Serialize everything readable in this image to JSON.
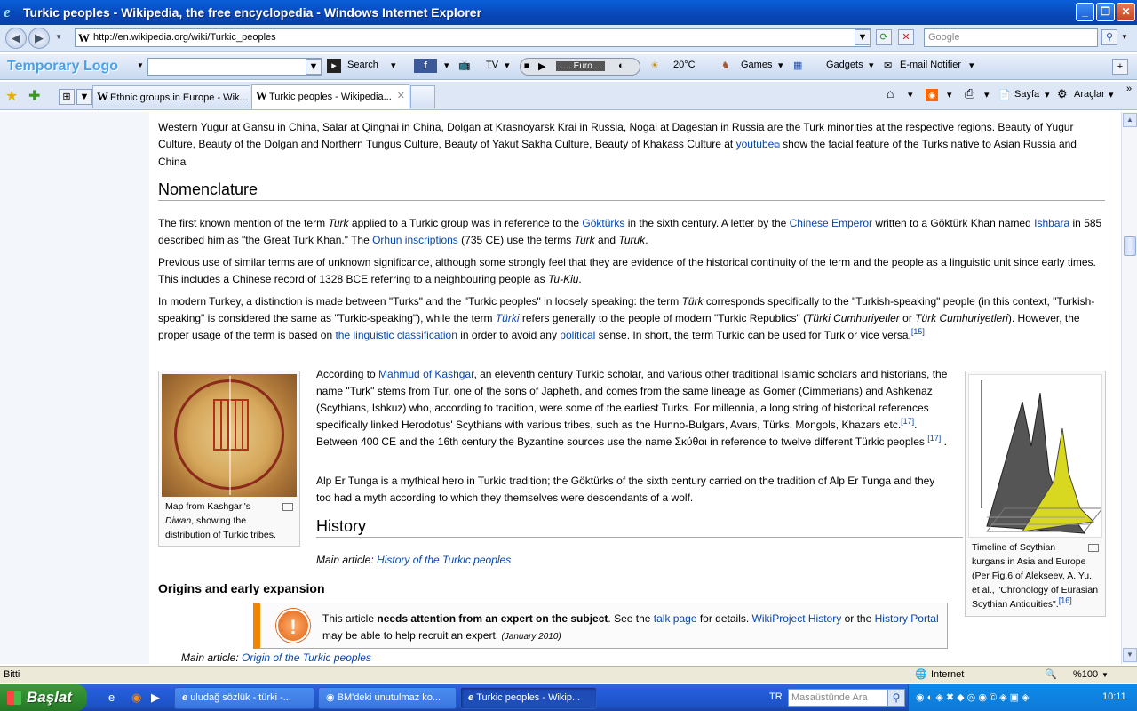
{
  "window": {
    "title": "Turkic peoples - Wikipedia, the free encyclopedia - Windows Internet Explorer"
  },
  "address": {
    "url": "http://en.wikipedia.org/wiki/Turkic_peoples",
    "search_placeholder": "Google"
  },
  "toolbar": {
    "logo": "Temporary Logo",
    "search_label": "Search",
    "tv_label": "TV",
    "radio_label": "..... Euro ...",
    "weather_label": "20°C",
    "games_label": "Games",
    "gadgets_label": "Gadgets",
    "email_label": "E-mail Notifier"
  },
  "tabs": [
    {
      "label": "Ethnic groups in Europe - Wik..."
    },
    {
      "label": "Turkic peoples - Wikipedia..."
    }
  ],
  "command_bar": {
    "page_label": "Sayfa",
    "tools_label": "Araçlar"
  },
  "article": {
    "p0": "Western Yugur at Gansu in China, Salar at Qinghai in China, Dolgan at Krasnoyarsk Krai in Russia, Nogai at Dagestan in Russia are the Turk minorities at the respective regions. Beauty of Yugur Culture, Beauty of the Dolgan and Northern Tungus Culture, Beauty of Yakut Sakha Culture, Beauty of Khakass Culture at",
    "p0_link": "youtube",
    "p0_tail": "show the facial feature of the Turks native to Asian Russia and China",
    "h_nomenclature": "Nomenclature",
    "n1": {
      "a": "The first known mention of the term",
      "turk": "Turk",
      "b": "applied to a Turkic group was in reference to the",
      "gokturks": "Göktürks",
      "c": "in the sixth century. A letter by the",
      "emperor": "Chinese Emperor",
      "d": "written to a Göktürk Khan named",
      "ishbara": "Ishbara",
      "e": "in 585 described him as \"the Great Turk Khan.\" The",
      "orhun": "Orhun inscriptions",
      "f": "(735 CE) use the terms",
      "turk2": "Turk",
      "and": "and",
      "turuk": "Turuk",
      "end": "."
    },
    "n2": {
      "a": "Previous use of similar terms are of unknown significance, although some strongly feel that they are evidence of the historical continuity of the term and the people as a linguistic unit since early times. This includes a Chinese record of 1328 BCE referring to a neighbouring people as",
      "tukiu": "Tu-Kiu",
      "end": "."
    },
    "n3": {
      "a": "In modern Turkey, a distinction is made between \"Turks\" and the \"Turkic peoples\" in loosely speaking: the term",
      "turk": "Türk",
      "b": "corresponds specifically to the \"Turkish-speaking\" people (in this context, \"Turkish-speaking\" is considered the same as \"Turkic-speaking\"), while the term",
      "turki": "Türki",
      "c": "refers generally to the people of modern \"Turkic Republics\" (",
      "cumh1": "Türki Cumhuriyetler",
      "or": "or",
      "cumh2": "Türk Cumhuriyetleri",
      "d": "). However, the proper usage of the term is based on",
      "ling": "the linguistic classification",
      "e": "in order to avoid any",
      "political": "political",
      "f": "sense. In short, the term Turkic can be used for Turk or vice versa.",
      "ref": "[15]"
    },
    "k1": {
      "a": "According to",
      "mahmud": "Mahmud of Kashgar",
      "b": ", an eleventh century Turkic scholar, and various other traditional Islamic scholars and historians, the name \"Turk\" stems from Tur, one of the sons of Japheth, and comes from the same lineage as Gomer (Cimmerians) and Ashkenaz (Scythians, Ishkuz) who, according to tradition, were some of the earliest Turks. For millennia, a long string of historical references specifically linked Herodotus' Scythians with various tribes, such as the Hunno-Bulgars, Avars, Türks, Mongols, Khazars etc.",
      "ref1": "[17]",
      "c": ". Between 400 CE and the 16th century the Byzantine sources use the name Σκύθαι in reference to twelve different Türkic peoples",
      "ref2": "[17]",
      "end": "."
    },
    "k2": "Alp Er Tunga is a mythical hero in Turkic tradition; the Göktürks of the sixth century carried on the tradition of Alp Er Tunga and they too had a myth according to which they themselves were descendants of a wolf.",
    "h_history": "History",
    "main1_label": "Main article:",
    "main1_link": "History of the Turkic peoples",
    "h_origins": "Origins and early expansion",
    "ambox": {
      "a": "This article",
      "bold": "needs attention from an expert on the subject",
      "b": ". See the",
      "talk": "talk page",
      "c": "for details.",
      "proj": "WikiProject History",
      "d": "or the",
      "portal": "History Portal",
      "e": "may be able to help recruit an expert.",
      "date": "(January 2010)"
    },
    "main2_label": "Main article:",
    "main2_link": "Origin of the Turkic peoples",
    "map_caption": {
      "a": "Map from Kashgari's",
      "diwan": "Diwan",
      "b": ", showing the distribution of Turkic tribes."
    },
    "chart_caption": {
      "text": "Timeline of Scythian kurgans in Asia and Europe (Per Fig.6 of Alekseev, A. Yu. et al., \"Chronology of Eurasian Scythian Antiquities\".",
      "ref": "[16]"
    }
  },
  "status": {
    "left": "Bitti",
    "zone": "Internet",
    "zoom": "%100"
  },
  "taskbar": {
    "start": "Başlat",
    "tasks": [
      "uludağ sözlük - türki -...",
      "BM'deki unutulmaz ko...",
      "Turkic peoples - Wikip..."
    ],
    "lang": "TR",
    "search_placeholder": "Masaüstünde Ara",
    "clock": "10:11"
  }
}
